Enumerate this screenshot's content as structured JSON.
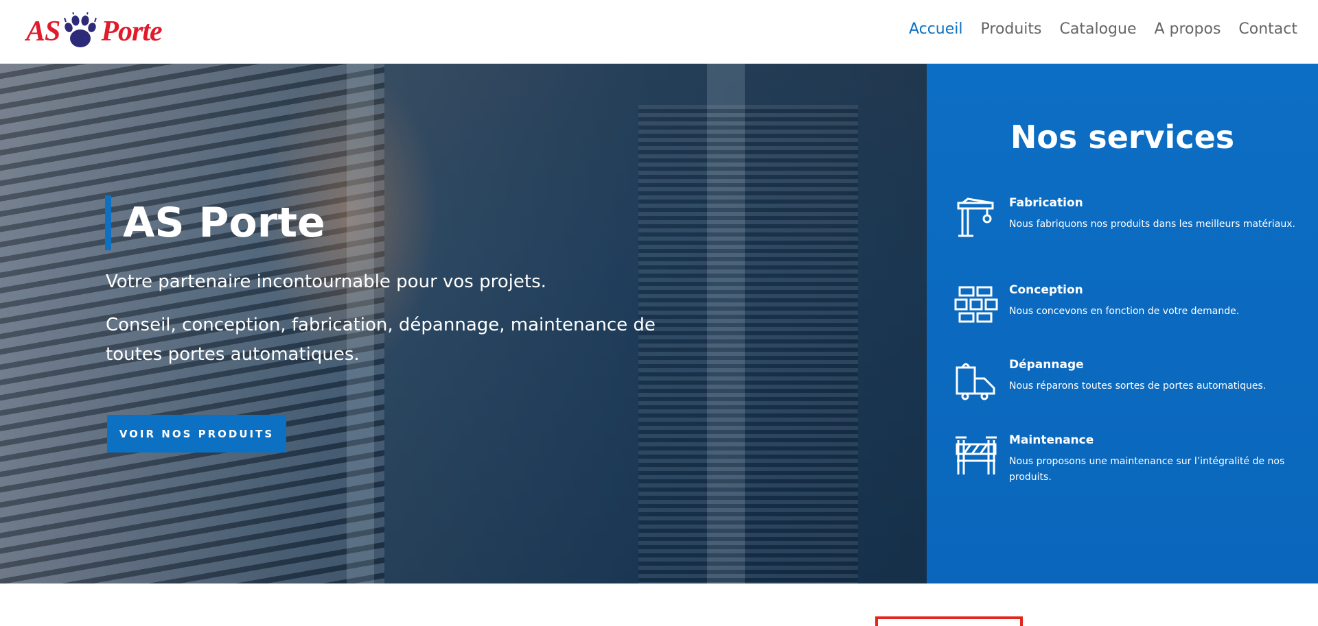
{
  "header": {
    "logo": {
      "left": "AS",
      "right": "Porte",
      "paw_icon": "paw-icon"
    },
    "nav": [
      {
        "label": "Accueil",
        "active": true
      },
      {
        "label": "Produits",
        "active": false
      },
      {
        "label": "Catalogue",
        "active": false
      },
      {
        "label": "A propos",
        "active": false
      },
      {
        "label": "Contact",
        "active": false
      }
    ]
  },
  "hero": {
    "title": "AS Porte",
    "subtitle": "Votre partenaire incontournable pour vos projets.",
    "description": "Conseil, conception, fabrication, dépannage, maintenance de toutes portes automatiques.",
    "button_label": "VOIR NOS PRODUITS"
  },
  "services": {
    "title": "Nos services",
    "items": [
      {
        "name": "Fabrication",
        "desc": "Nous fabriquons nos produits dans les meilleurs matériaux.",
        "icon": "crane-icon"
      },
      {
        "name": "Conception",
        "desc": "Nous concevons en fonction de votre demande.",
        "icon": "bricks-icon"
      },
      {
        "name": "Dépannage",
        "desc": "Nous réparons toutes sortes de portes automatiques.",
        "icon": "truck-icon"
      },
      {
        "name": "Maintenance",
        "desc": "Nous proposons une maintenance sur l’intégralité de nos produits.",
        "icon": "barrier-icon"
      }
    ]
  },
  "colors": {
    "accent": "#0c71c3",
    "logo_red": "#e01b2b",
    "logo_paw": "#2e2a7a",
    "nav_text": "#666666"
  }
}
